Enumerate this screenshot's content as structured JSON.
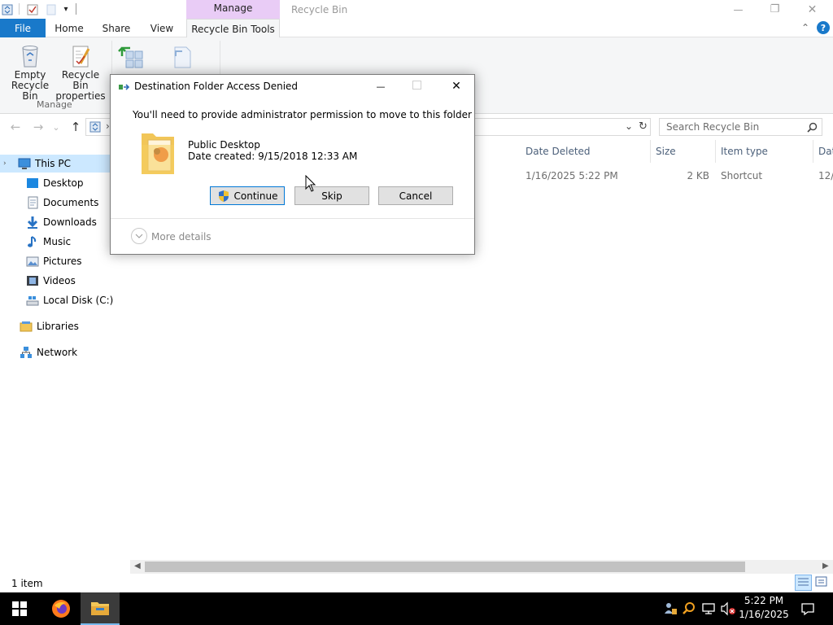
{
  "quick_access": {
    "customize_symbol": "▾"
  },
  "ribbon_tabs": {
    "contextual_group": "Manage",
    "window_title": "Recycle Bin",
    "tabs": [
      "File",
      "Home",
      "Share",
      "View",
      "Recycle Bin Tools"
    ],
    "active_tab": "Recycle Bin Tools"
  },
  "window_controls": {
    "minimize_symbol": "—",
    "maximize_symbol": "❐",
    "close_symbol": "✕",
    "collapse_ribbon_symbol": "⌃",
    "help_symbol": "?"
  },
  "ribbon": {
    "empty_bin_line1": "Empty",
    "empty_bin_line2": "Recycle Bin",
    "properties_line1": "Recycle Bin",
    "properties_line2": "properties",
    "group_manage": "Manage"
  },
  "address": {
    "breadcrumb_sep": "›",
    "dropdown_symbol": "⌄",
    "refresh_symbol": "↻",
    "search_placeholder": "Search Recycle Bin"
  },
  "navigation": {
    "back_symbol": "←",
    "forward_symbol": "→",
    "recent_symbol": "⌄",
    "up_symbol": "↑"
  },
  "nav_pane": {
    "items": [
      {
        "label": "This PC",
        "icon": "pc-icon"
      },
      {
        "label": "Desktop",
        "icon": "desktop-icon"
      },
      {
        "label": "Documents",
        "icon": "documents-icon"
      },
      {
        "label": "Downloads",
        "icon": "downloads-icon"
      },
      {
        "label": "Music",
        "icon": "music-icon"
      },
      {
        "label": "Pictures",
        "icon": "pictures-icon"
      },
      {
        "label": "Videos",
        "icon": "videos-icon"
      },
      {
        "label": "Local Disk (C:)",
        "icon": "disk-icon"
      },
      {
        "label": "Libraries",
        "icon": "libraries-icon"
      },
      {
        "label": "Network",
        "icon": "network-icon"
      }
    ],
    "selected": "This PC"
  },
  "file_list": {
    "columns": [
      "Date Deleted",
      "Size",
      "Item type",
      "Dat"
    ],
    "rows": [
      {
        "date_deleted": "1/16/2025 5:22 PM",
        "size": "2 KB",
        "item_type": "Shortcut",
        "date_modified": "12/"
      }
    ]
  },
  "status_bar": {
    "item_count": "1 item"
  },
  "dialog": {
    "title": "Destination Folder Access Denied",
    "message": "You'll need to provide administrator permission to move to this folder",
    "folder_name": "Public Desktop",
    "date_created": "Date created: 9/15/2018 12:33 AM",
    "continue_label": "Continue",
    "skip_label": "Skip",
    "cancel_label": "Cancel",
    "more_details": "More details",
    "minimize_symbol": "—",
    "close_symbol": "✕"
  },
  "taskbar": {
    "clock_time": "5:22 PM",
    "clock_date": "1/16/2025"
  },
  "colors": {
    "file_tab": "#1979ca",
    "contextual_tab": "#e9ccf6",
    "selection": "#cce8ff",
    "taskbar": "#000000",
    "accent": "#0078d7"
  }
}
